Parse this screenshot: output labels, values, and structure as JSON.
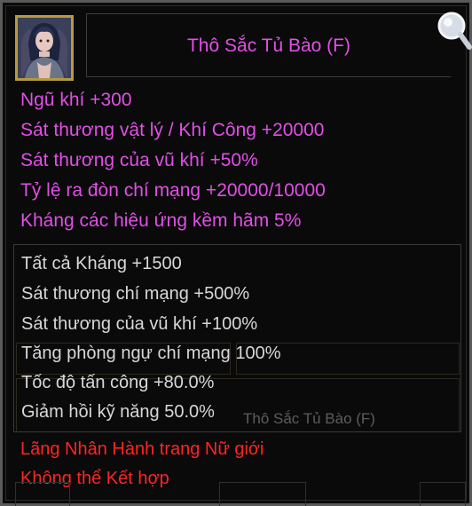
{
  "item": {
    "name": "Thô Sắc Tủ Bào (F)",
    "colors": {
      "name": "#e14fe6",
      "magic": "#e14fe6",
      "stat": "#d8d8d8",
      "requirement": "#ff2424",
      "border_gold": "#b79a3c"
    }
  },
  "magic_attributes": [
    "Ngũ khí +300",
    "Sát thương vật lý / Khí Công +20000",
    "Sát thương của vũ khí +50%",
    "Tỷ lệ ra đòn chí mạng +20000/10000",
    "Kháng các hiệu ứng kềm hãm 5%"
  ],
  "base_stats": [
    "Tất cả Kháng +1500",
    "Sát thương chí mạng +500%",
    "Sát thương của vũ khí +100%",
    "Tăng phòng ngự chí mạng 100%",
    "Tốc độ tấn công +80.0%",
    "Giảm hồi kỹ năng 50.0%"
  ],
  "background_ghost_text": "Thô Sắc Tủ Bào (F)",
  "requirements": [
    "Lãng Nhân Hành trang Nữ giới",
    "Không thể Kết hợp"
  ],
  "icons": {
    "portrait": "female-character-portrait-icon",
    "search": "magnifying-glass-icon"
  }
}
